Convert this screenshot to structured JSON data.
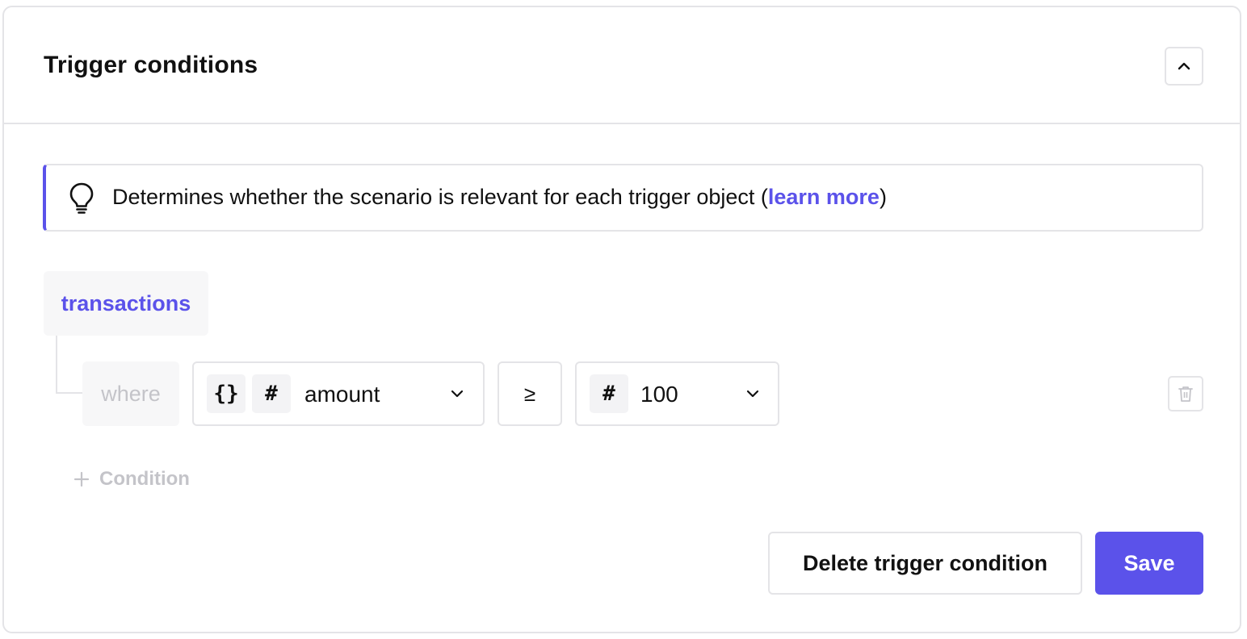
{
  "header": {
    "title": "Trigger conditions",
    "collapse_icon": "chevron-up-icon"
  },
  "info": {
    "icon": "lightbulb-icon",
    "text_before": "Determines whether the scenario is relevant for each trigger object (",
    "link_label": "learn more",
    "text_after": ")"
  },
  "builder": {
    "object_label": "transactions",
    "where_label": "where",
    "condition": {
      "field_badges": [
        "{}",
        "#"
      ],
      "field_label": "amount",
      "operator": "≥",
      "value_badge": "#",
      "value": "100"
    },
    "add_condition_label": "Condition"
  },
  "footer": {
    "delete_label": "Delete trigger condition",
    "save_label": "Save"
  },
  "colors": {
    "accent": "#5b52ea",
    "border": "#e4e4e7",
    "muted_text": "#c4c4c9"
  }
}
